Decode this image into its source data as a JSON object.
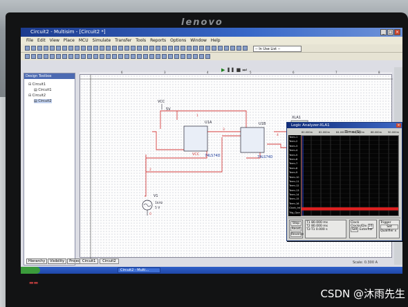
{
  "monitor": {
    "brand": "lenovo"
  },
  "window": {
    "title": "Circuit2 - Multisim - [Circuit2 *]"
  },
  "menu": [
    "File",
    "Edit",
    "View",
    "Place",
    "MCU",
    "Simulate",
    "Transfer",
    "Tools",
    "Reports",
    "Options",
    "Window",
    "Help"
  ],
  "toolbar": {
    "in_use_list": "-- In Use List --"
  },
  "toolbox": {
    "title": "Design Toolbox",
    "tree": [
      "Circuit1",
      "Circuit1",
      "Circuit2",
      "Circuit2"
    ],
    "tabs": [
      "Hierarchy",
      "Visibility",
      "Project View"
    ]
  },
  "canvas": {
    "tabs": [
      "Circuit1",
      "Circuit2"
    ],
    "zoom_label": "Scale: 0.300 A",
    "ruler": [
      "6",
      "3",
      "4",
      "5",
      "6",
      "7",
      "8"
    ],
    "labels": {
      "vcc_top": "VCC",
      "vcc_5v": "5V",
      "u1a": "U1A",
      "u1b": "U1B",
      "chip1": "74LS74D",
      "chip2": "74LS74D",
      "vcc_mid": "VCC",
      "v1": "V1",
      "v1_freq": "1kHz",
      "v1_amp": "5 V",
      "xla1": "XLA1",
      "net_1": "1",
      "net_2": "2",
      "net_3": "3",
      "net_4": "4",
      "net_0": "0",
      "xla_pins": "C Q T"
    }
  },
  "logic_analyzer": {
    "title": "Logic Analyzer-XLA1",
    "time_label": "Time (S)",
    "time_ticks": [
      "80.000m",
      "82.000m",
      "84.000m",
      "86.000m",
      "88.000m",
      "90.000m"
    ],
    "channels": [
      "Term-1",
      "Term-2",
      "Term-3",
      "Term-4",
      "Term-5",
      "Term-6",
      "Term-7",
      "Term-8",
      "Term-9",
      "Term-10",
      "Term-11",
      "Term-12",
      "Term-13",
      "Term-14",
      "Term-15",
      "Term-16",
      "Clock_Int",
      "Trig_Qua"
    ],
    "controls": {
      "stop": "Stop",
      "reset": "Reset",
      "reverse": "Reverse",
      "t1": "T1",
      "t2": "T2",
      "t2_t1": "T2-T1",
      "t1_val": "80.000 ms",
      "t2_val": "80.000 ms",
      "dt_val": "0.000 s",
      "clock_label": "Clock",
      "clocks_div": "Clocks/Div",
      "clocks_div_val": "16",
      "set": "Set",
      "external": "External",
      "trigger_label": "Trigger",
      "qualifier": "Qualifier",
      "qualifier_val": "x"
    }
  },
  "taskbar": {
    "start": "",
    "item": "Circuit2 - Multi..."
  },
  "watermark": "CSDN @沐雨先生",
  "colors": {
    "wire": "#d23b3b",
    "plot_bg": "#050505",
    "grid": "#8a8a8a",
    "trace": "#e02020",
    "titlebar": "#1d3c8f"
  }
}
